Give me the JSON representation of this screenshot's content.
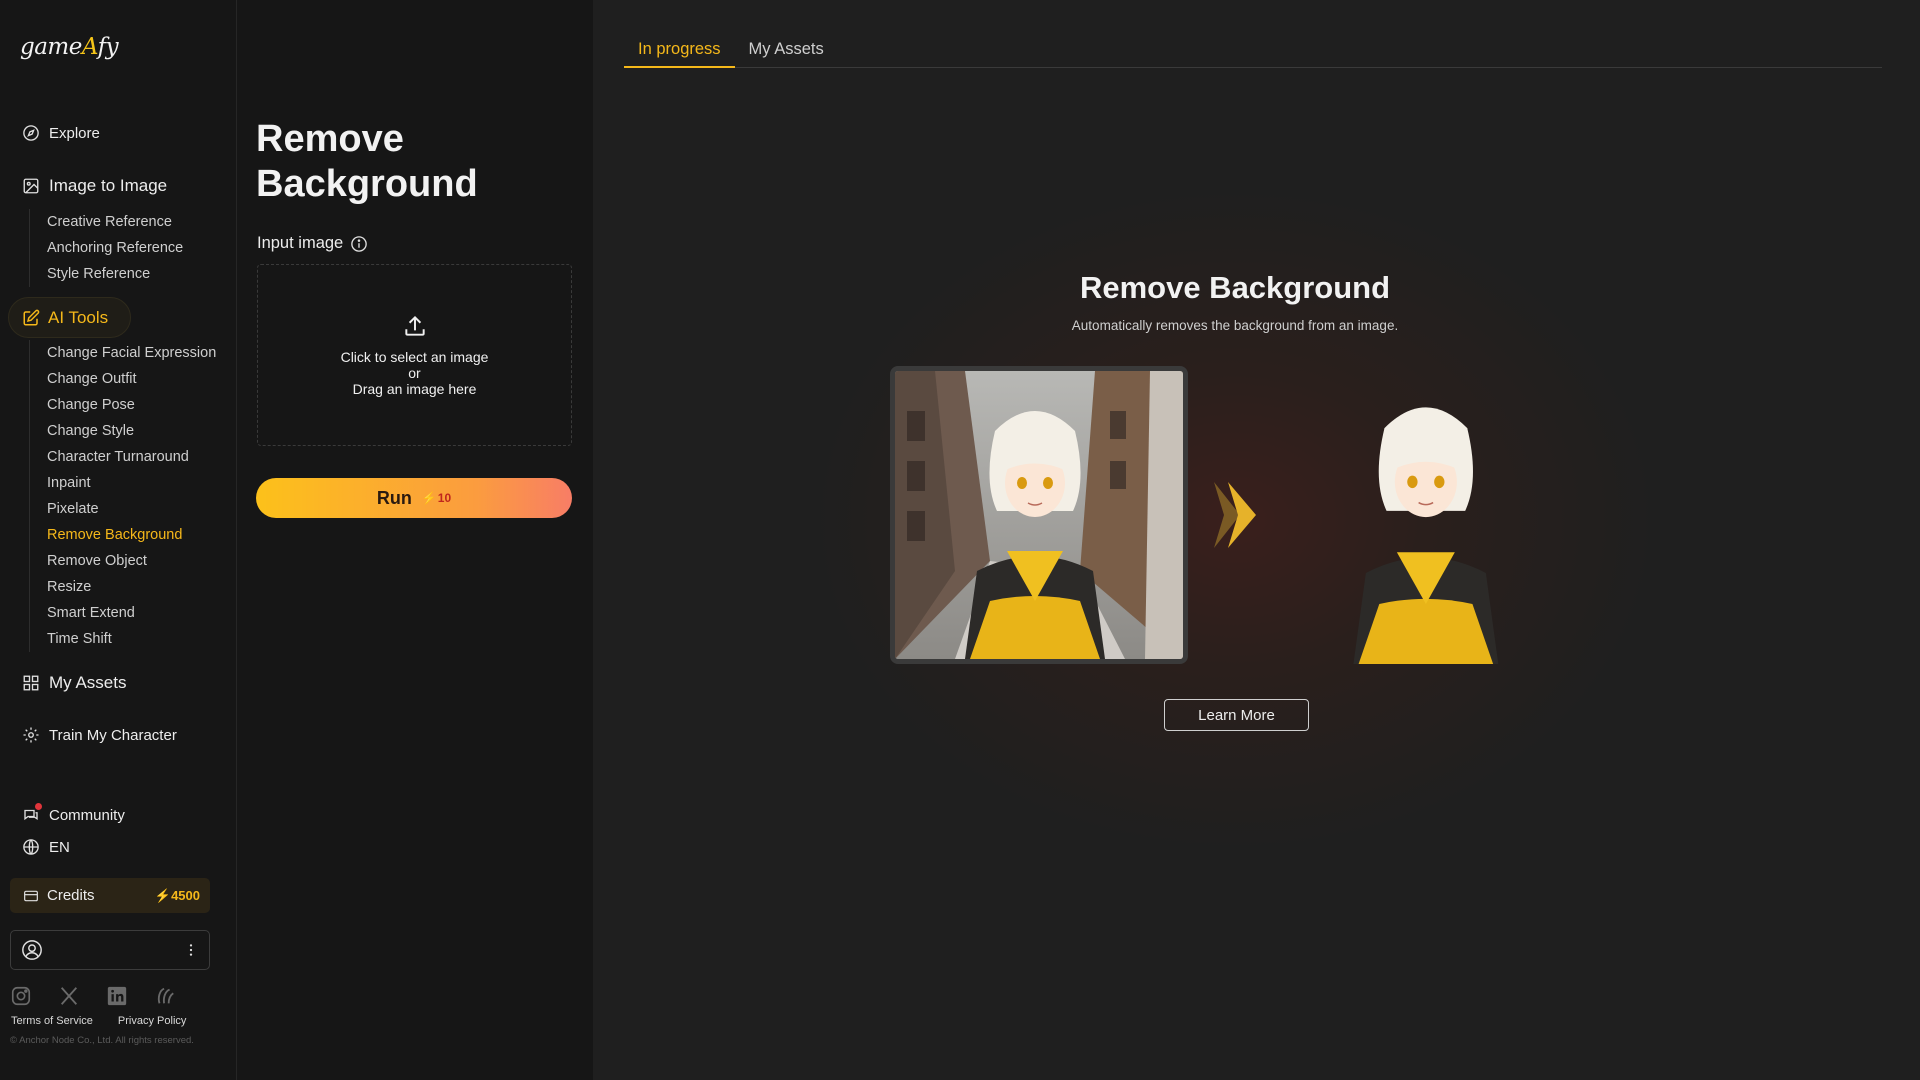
{
  "brand": {
    "logo_text_pre": "game",
    "logo_text_post": "fy",
    "logo_letter": "A"
  },
  "sidebar": {
    "explore": "Explore",
    "image_to_image": {
      "label": "Image to Image",
      "items": [
        "Creative Reference",
        "Anchoring Reference",
        "Style Reference"
      ]
    },
    "ai_tools": {
      "label": "AI Tools",
      "items": [
        "Change Facial Expression",
        "Change Outfit",
        "Change Pose",
        "Change Style",
        "Character Turnaround",
        "Inpaint",
        "Pixelate",
        "Remove Background",
        "Remove Object",
        "Resize",
        "Smart Extend",
        "Time Shift"
      ],
      "active_item": "Remove Background"
    },
    "my_assets": "My Assets",
    "train_my_character": "Train My Character",
    "community": "Community",
    "language": "EN",
    "credits": {
      "label": "Credits",
      "amount": "4500"
    },
    "footer": {
      "terms": "Terms of Service",
      "privacy": "Privacy Policy",
      "copyright": "© Anchor Node Co., Ltd. All rights reserved."
    },
    "socials": [
      "instagram-icon",
      "x-icon",
      "linkedin-icon",
      "threads-icon"
    ]
  },
  "form": {
    "title": "Remove Background",
    "input_label": "Input image",
    "dropzone": {
      "line1": "Click to select an image",
      "line2": "or",
      "line3": "Drag an image here"
    },
    "run": {
      "label": "Run",
      "cost": "10"
    }
  },
  "main": {
    "tabs": [
      {
        "label": "In progress",
        "active": true
      },
      {
        "label": "My Assets",
        "active": false
      }
    ],
    "hero": {
      "title": "Remove Background",
      "subtitle": "Automatically removes the background from an image.",
      "learn_more": "Learn More"
    }
  },
  "colors": {
    "accent": "#f5b81a",
    "background": "#161616",
    "panel": "#1f1f1f"
  }
}
